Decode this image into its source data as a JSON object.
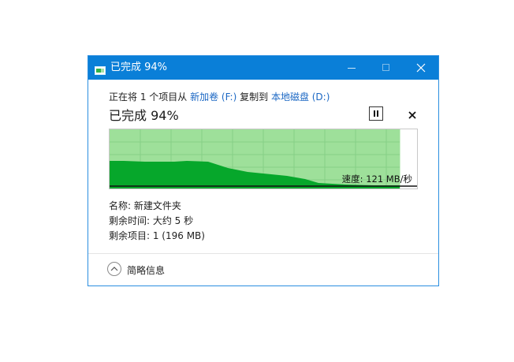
{
  "window": {
    "title": "已完成 94%",
    "icon": "copy-progress-icon",
    "controls": [
      "minimize-icon",
      "maximize-icon",
      "close-icon"
    ]
  },
  "copy": {
    "prefix": "正在将 1 个项目从 ",
    "source": "新加卷 (F:)",
    "middle": " 复制到 ",
    "destination": "本地磁盘 (D:)"
  },
  "progress": {
    "title": "已完成 94%",
    "percent": 94,
    "speed_label": "速度: 121 MB/秒"
  },
  "buttons": {
    "pause_icon": "pause-icon",
    "cancel_icon": "close-icon"
  },
  "info": {
    "name": "名称: 新建文件夹",
    "time_remaining": "剩余时间: 大约 5 秒",
    "items_remaining": "剩余项目: 1 (196 MB)"
  },
  "footer": {
    "details_label": "简略信息",
    "details_icon": "chevron-up-icon"
  },
  "colors": {
    "titlebar": "#0a7fd8",
    "graph_fill": "#9ee09a",
    "graph_speed": "#06a72b",
    "link": "#1c68c4"
  }
}
